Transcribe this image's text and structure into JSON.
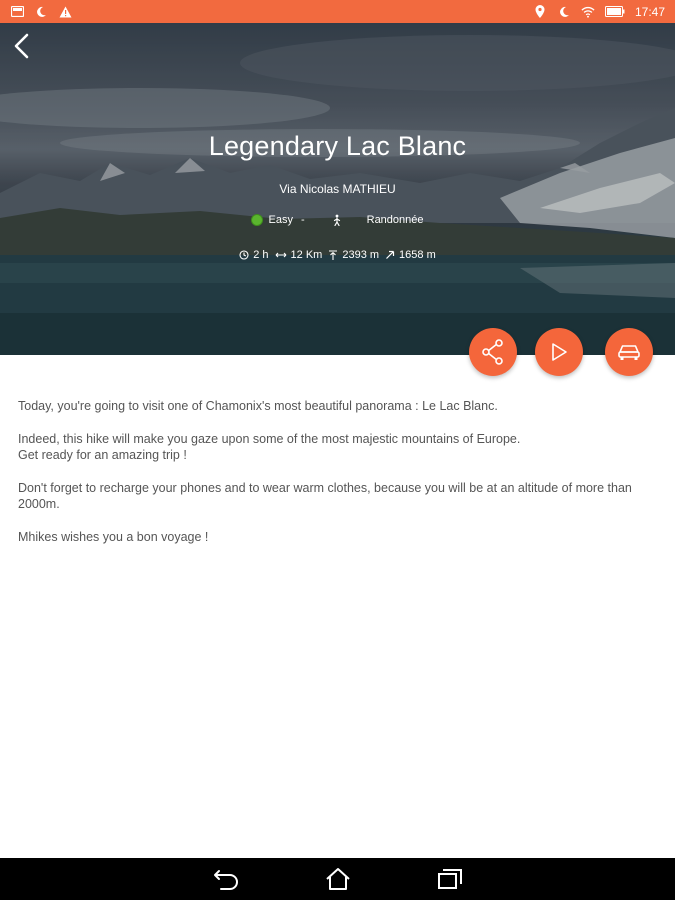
{
  "status_bar": {
    "time": "17:47",
    "left_icons": [
      "gallery-icon",
      "moon-icon",
      "warning-icon"
    ],
    "right_icons": [
      "location-icon",
      "moon-icon",
      "wifi-icon",
      "battery-icon"
    ],
    "color": "#f26a3f"
  },
  "hero": {
    "title": "Legendary Lac Blanc",
    "author": "Via Nicolas MATHIEU",
    "difficulty": "Easy",
    "separator": "-",
    "activity": "Randonnée",
    "stats": {
      "duration": "2 h",
      "distance": "12 Km",
      "elevation_max": "2393 m",
      "elevation_gain": "1658 m"
    }
  },
  "actions": {
    "share": "share-icon",
    "play": "play-icon",
    "car": "car-icon",
    "color": "#f4663b"
  },
  "description": {
    "p1": "Today, you're going to visit one of Chamonix's most beautiful panorama : Le Lac Blanc.",
    "p2": "Indeed, this hike will make you gaze upon some of the most majestic mountains of Europe.\nGet ready for an amazing trip !",
    "p3": "Don't forget to recharge your phones and to wear warm clothes, because you will be at an altitude of more than 2000m.",
    "p4": "Mhikes wishes you a bon voyage !"
  },
  "nav": [
    "back-icon",
    "home-icon",
    "recents-icon"
  ]
}
